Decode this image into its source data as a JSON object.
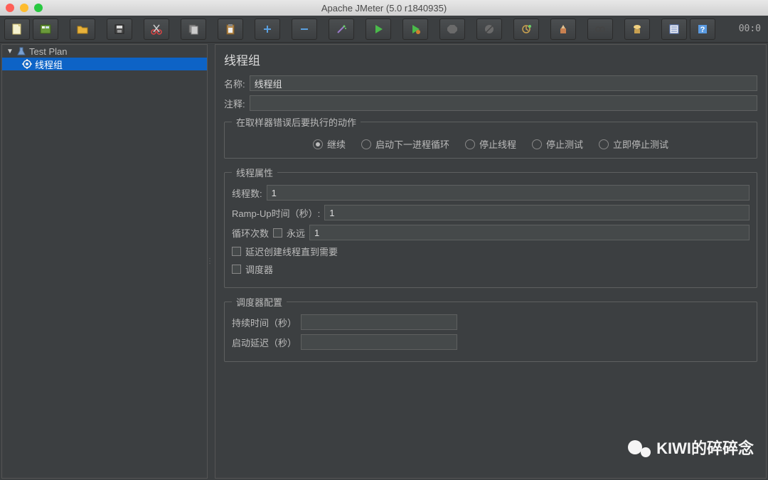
{
  "window": {
    "title": "Apache JMeter (5.0 r1840935)"
  },
  "toolbar": {
    "timer": "00:0",
    "icons": [
      "new-file",
      "open-templates",
      "open-file",
      "save",
      "cut",
      "copy",
      "paste",
      "add",
      "remove",
      "magic-wand",
      "play",
      "play-no-pause",
      "stop",
      "shutdown",
      "cog-brush",
      "broom",
      "binoculars",
      "clear",
      "notebook",
      "help"
    ]
  },
  "tree": {
    "root": {
      "label": "Test Plan"
    },
    "child": {
      "label": "线程组"
    }
  },
  "panel": {
    "title": "线程组",
    "name_label": "名称:",
    "name_value": "线程组",
    "comment_label": "注释:",
    "comment_value": "",
    "on_error": {
      "legend": "在取样器错误后要执行的动作",
      "options": [
        "继续",
        "启动下一进程循环",
        "停止线程",
        "停止测试",
        "立即停止测试"
      ],
      "selected": "继续"
    },
    "thread_props": {
      "legend": "线程属性",
      "threads_label": "线程数:",
      "threads_value": "1",
      "rampup_label": "Ramp-Up时间（秒）:",
      "rampup_value": "1",
      "loop_label": "循环次数",
      "forever_label": "永远",
      "loop_value": "1",
      "delay_start_label": "延迟创建线程直到需要",
      "scheduler_label": "调度器"
    },
    "scheduler": {
      "legend": "调度器配置",
      "duration_label": "持续时间（秒）",
      "duration_value": "",
      "startup_delay_label": "启动延迟（秒）",
      "startup_delay_value": ""
    }
  },
  "watermark": "KIWI的碎碎念"
}
